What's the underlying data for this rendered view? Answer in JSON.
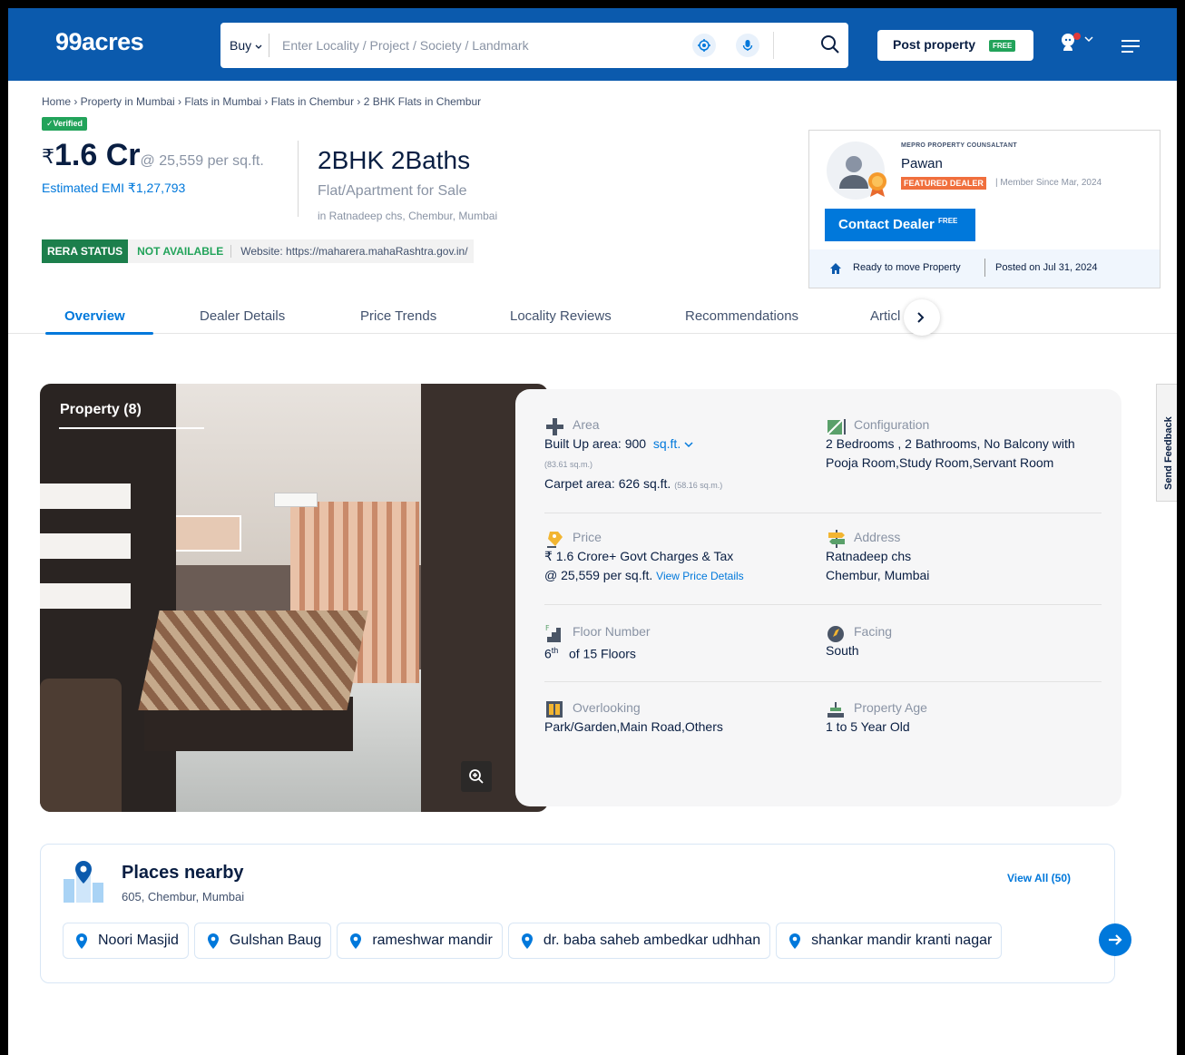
{
  "header": {
    "logo": "99acres",
    "buy_label": "Buy",
    "search_placeholder": "Enter Locality / Project / Society / Landmark",
    "post_property": "Post property",
    "post_free": "FREE",
    "brand_color": "#0b5aad"
  },
  "breadcrumb": "Home › Property in Mumbai › Flats in Mumbai › Flats in Chembur › 2 BHK Flats in Chembur",
  "listing": {
    "verified": "✓Verified",
    "rupee": "₹",
    "price": "1.6 Cr",
    "price_per_sqft": "@ 25,559 per sq.ft.",
    "emi": "Estimated EMI ₹1,27,793",
    "config": "2BHK 2Baths",
    "type": "Flat/Apartment for Sale",
    "location": "in Ratnadeep chs, Chembur, Mumbai",
    "rera_label": "RERA STATUS",
    "rera_value": "NOT AVAILABLE",
    "rera_site": "Website: https://maharera.mahaRashtra.gov.in/"
  },
  "dealer": {
    "org": "MEPRO PROPERTY COUNSALTANT",
    "name": "Pawan",
    "featured": "FEATURED DEALER",
    "member_since": "| Member Since Mar, 2024",
    "contact": "Contact Dealer",
    "contact_free": "FREE",
    "ready": "Ready to move Property",
    "posted": "Posted on Jul 31, 2024"
  },
  "tabs": [
    "Overview",
    "Dealer Details",
    "Price Trends",
    "Locality Reviews",
    "Recommendations",
    "Articl"
  ],
  "gallery": {
    "title": "Property (8)"
  },
  "details": {
    "area_head": "Area",
    "area_built": "Built Up area: 900",
    "area_unit": "sq.ft.",
    "area_sqm": "(83.61 sq.m.)",
    "area_carpet": "Carpet area: 626 sq.ft.",
    "area_carpet_sqm": "(58.16 sq.m.)",
    "config_head": "Configuration",
    "config_value": "2 Bedrooms , 2 Bathrooms, No Balcony with Pooja Room,Study Room,Servant Room",
    "price_head": "Price",
    "price_line1": "₹ 1.6 Crore+ Govt Charges & Tax",
    "price_line2": "@ 25,559 per sq.ft.",
    "price_link": "View Price Details",
    "address_head": "Address",
    "address_line1": "Ratnadeep chs",
    "address_line2": "Chembur, Mumbai",
    "floor_head": "Floor Number",
    "floor_num": "6",
    "floor_sup": "th",
    "floor_total": "of 15 Floors",
    "facing_head": "Facing",
    "facing_value": "South",
    "overlooking_head": "Overlooking",
    "overlooking_value": "Park/Garden,Main Road,Others",
    "age_head": "Property Age",
    "age_value": "1 to 5 Year Old"
  },
  "feedback": "Send Feedback",
  "places": {
    "title": "Places nearby",
    "subtitle": "605, Chembur, Mumbai",
    "view_all": "View All (50)",
    "items": [
      "Noori Masjid",
      "Gulshan Baug",
      "rameshwar mandir",
      "dr. baba saheb ambedkar udhhan",
      "shankar mandir kranti nagar"
    ]
  }
}
